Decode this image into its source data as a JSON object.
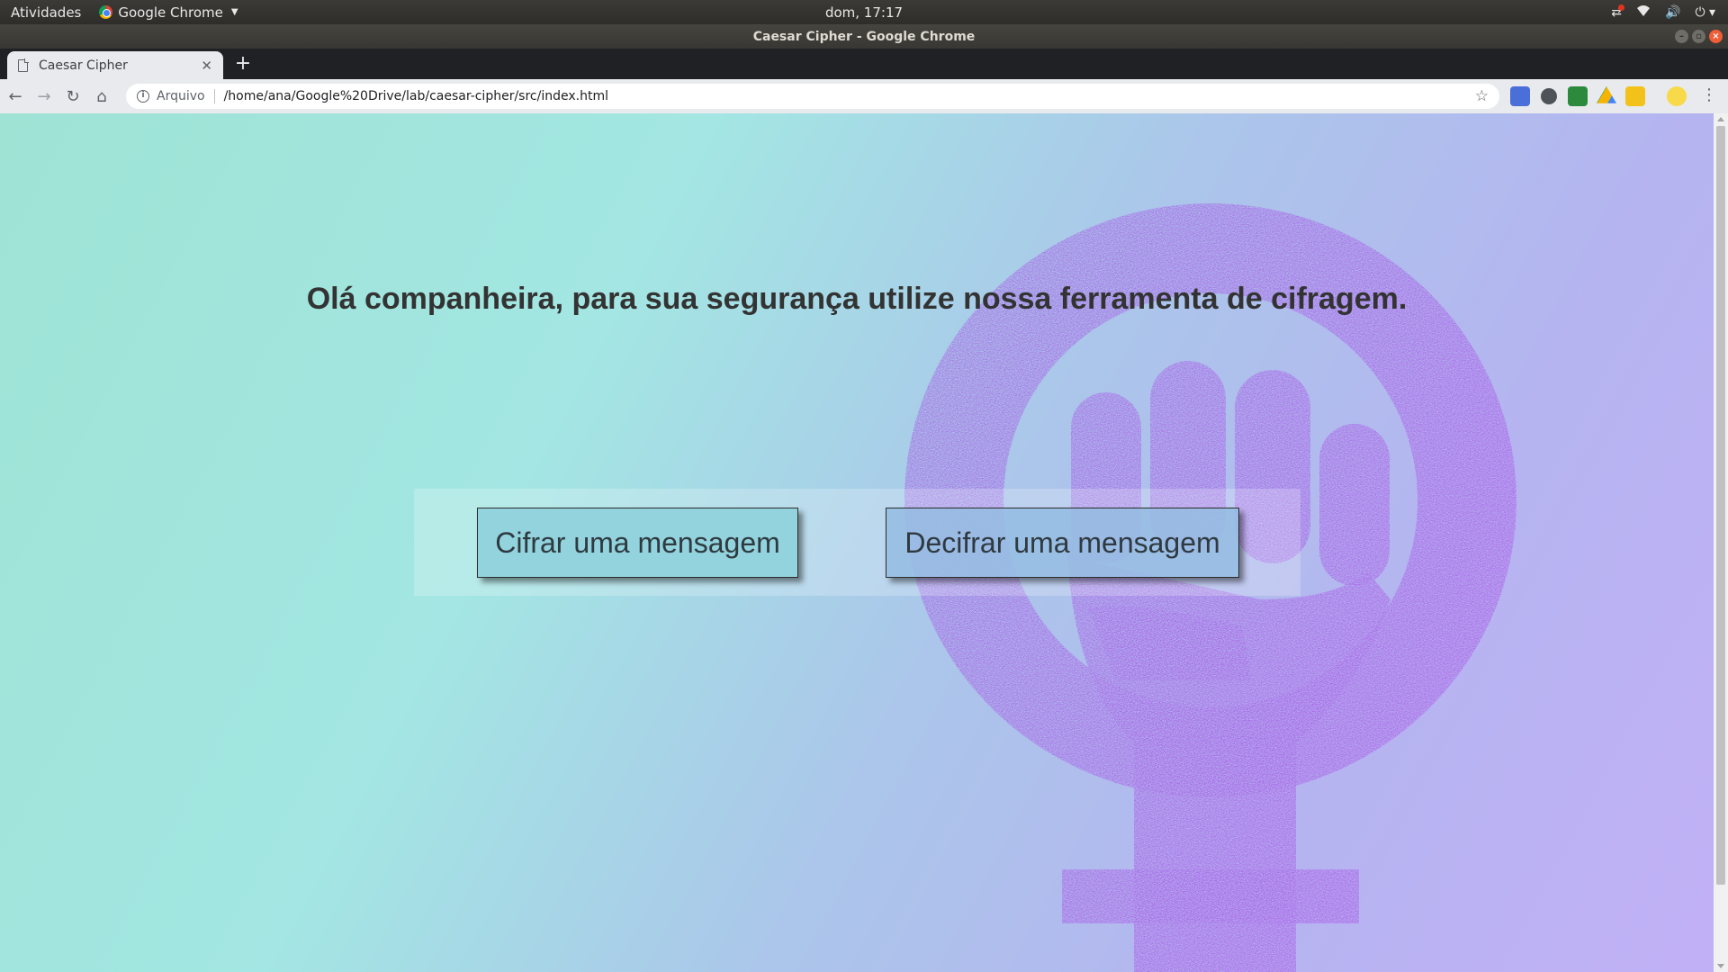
{
  "system_panel": {
    "activities": "Atividades",
    "app_name": "Google Chrome",
    "clock": "dom, 17:17"
  },
  "window": {
    "title": "Caesar Cipher - Google Chrome"
  },
  "browser": {
    "tab_title": "Caesar Cipher",
    "url_scheme_label": "Arquivo",
    "url": "/home/ana/Google%20Drive/lab/caesar-cipher/src/index.html"
  },
  "page": {
    "heading": "Olá companheira, para sua segurança utilize nossa ferramenta de cifragem.",
    "cipher_button": "Cifrar uma mensagem",
    "decipher_button": "Decifrar uma mensagem"
  },
  "icons": {
    "back": "arrow-left-icon",
    "forward": "arrow-right-icon",
    "reload": "reload-icon",
    "home": "home-icon",
    "bookmark": "star-icon",
    "menu": "three-dots-icon"
  },
  "colors": {
    "cipher_button": "#92d3de",
    "heading_text": "#333333",
    "emblem": "#a845e6"
  }
}
